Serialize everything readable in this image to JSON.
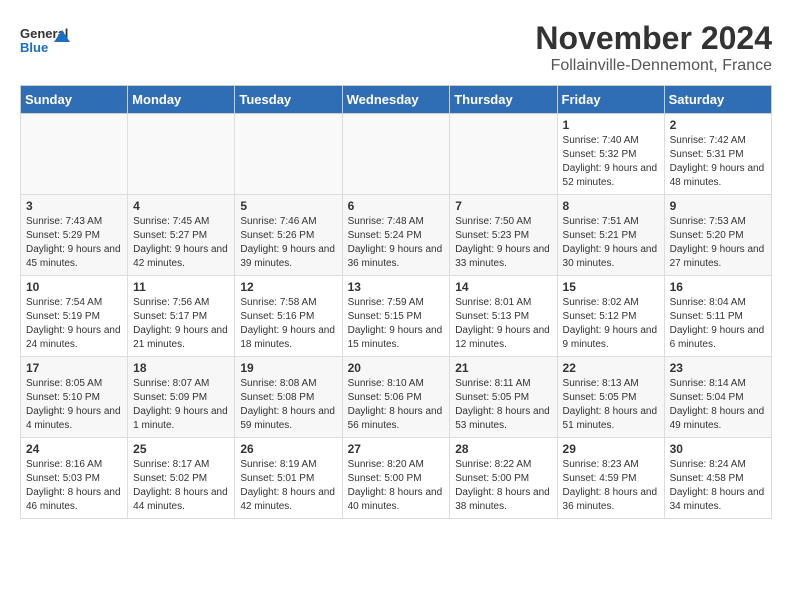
{
  "logo": {
    "text_general": "General",
    "text_blue": "Blue"
  },
  "title": "November 2024",
  "subtitle": "Follainville-Dennemont, France",
  "days_of_week": [
    "Sunday",
    "Monday",
    "Tuesday",
    "Wednesday",
    "Thursday",
    "Friday",
    "Saturday"
  ],
  "weeks": [
    {
      "cells": [
        {
          "day": null,
          "empty": true
        },
        {
          "day": null,
          "empty": true
        },
        {
          "day": null,
          "empty": true
        },
        {
          "day": null,
          "empty": true
        },
        {
          "day": null,
          "empty": true
        },
        {
          "day": "1",
          "sunrise": "Sunrise: 7:40 AM",
          "sunset": "Sunset: 5:32 PM",
          "daylight": "Daylight: 9 hours and 52 minutes."
        },
        {
          "day": "2",
          "sunrise": "Sunrise: 7:42 AM",
          "sunset": "Sunset: 5:31 PM",
          "daylight": "Daylight: 9 hours and 48 minutes."
        }
      ]
    },
    {
      "cells": [
        {
          "day": "3",
          "sunrise": "Sunrise: 7:43 AM",
          "sunset": "Sunset: 5:29 PM",
          "daylight": "Daylight: 9 hours and 45 minutes."
        },
        {
          "day": "4",
          "sunrise": "Sunrise: 7:45 AM",
          "sunset": "Sunset: 5:27 PM",
          "daylight": "Daylight: 9 hours and 42 minutes."
        },
        {
          "day": "5",
          "sunrise": "Sunrise: 7:46 AM",
          "sunset": "Sunset: 5:26 PM",
          "daylight": "Daylight: 9 hours and 39 minutes."
        },
        {
          "day": "6",
          "sunrise": "Sunrise: 7:48 AM",
          "sunset": "Sunset: 5:24 PM",
          "daylight": "Daylight: 9 hours and 36 minutes."
        },
        {
          "day": "7",
          "sunrise": "Sunrise: 7:50 AM",
          "sunset": "Sunset: 5:23 PM",
          "daylight": "Daylight: 9 hours and 33 minutes."
        },
        {
          "day": "8",
          "sunrise": "Sunrise: 7:51 AM",
          "sunset": "Sunset: 5:21 PM",
          "daylight": "Daylight: 9 hours and 30 minutes."
        },
        {
          "day": "9",
          "sunrise": "Sunrise: 7:53 AM",
          "sunset": "Sunset: 5:20 PM",
          "daylight": "Daylight: 9 hours and 27 minutes."
        }
      ]
    },
    {
      "cells": [
        {
          "day": "10",
          "sunrise": "Sunrise: 7:54 AM",
          "sunset": "Sunset: 5:19 PM",
          "daylight": "Daylight: 9 hours and 24 minutes."
        },
        {
          "day": "11",
          "sunrise": "Sunrise: 7:56 AM",
          "sunset": "Sunset: 5:17 PM",
          "daylight": "Daylight: 9 hours and 21 minutes."
        },
        {
          "day": "12",
          "sunrise": "Sunrise: 7:58 AM",
          "sunset": "Sunset: 5:16 PM",
          "daylight": "Daylight: 9 hours and 18 minutes."
        },
        {
          "day": "13",
          "sunrise": "Sunrise: 7:59 AM",
          "sunset": "Sunset: 5:15 PM",
          "daylight": "Daylight: 9 hours and 15 minutes."
        },
        {
          "day": "14",
          "sunrise": "Sunrise: 8:01 AM",
          "sunset": "Sunset: 5:13 PM",
          "daylight": "Daylight: 9 hours and 12 minutes."
        },
        {
          "day": "15",
          "sunrise": "Sunrise: 8:02 AM",
          "sunset": "Sunset: 5:12 PM",
          "daylight": "Daylight: 9 hours and 9 minutes."
        },
        {
          "day": "16",
          "sunrise": "Sunrise: 8:04 AM",
          "sunset": "Sunset: 5:11 PM",
          "daylight": "Daylight: 9 hours and 6 minutes."
        }
      ]
    },
    {
      "cells": [
        {
          "day": "17",
          "sunrise": "Sunrise: 8:05 AM",
          "sunset": "Sunset: 5:10 PM",
          "daylight": "Daylight: 9 hours and 4 minutes."
        },
        {
          "day": "18",
          "sunrise": "Sunrise: 8:07 AM",
          "sunset": "Sunset: 5:09 PM",
          "daylight": "Daylight: 9 hours and 1 minute."
        },
        {
          "day": "19",
          "sunrise": "Sunrise: 8:08 AM",
          "sunset": "Sunset: 5:08 PM",
          "daylight": "Daylight: 8 hours and 59 minutes."
        },
        {
          "day": "20",
          "sunrise": "Sunrise: 8:10 AM",
          "sunset": "Sunset: 5:06 PM",
          "daylight": "Daylight: 8 hours and 56 minutes."
        },
        {
          "day": "21",
          "sunrise": "Sunrise: 8:11 AM",
          "sunset": "Sunset: 5:05 PM",
          "daylight": "Daylight: 8 hours and 53 minutes."
        },
        {
          "day": "22",
          "sunrise": "Sunrise: 8:13 AM",
          "sunset": "Sunset: 5:05 PM",
          "daylight": "Daylight: 8 hours and 51 minutes."
        },
        {
          "day": "23",
          "sunrise": "Sunrise: 8:14 AM",
          "sunset": "Sunset: 5:04 PM",
          "daylight": "Daylight: 8 hours and 49 minutes."
        }
      ]
    },
    {
      "cells": [
        {
          "day": "24",
          "sunrise": "Sunrise: 8:16 AM",
          "sunset": "Sunset: 5:03 PM",
          "daylight": "Daylight: 8 hours and 46 minutes."
        },
        {
          "day": "25",
          "sunrise": "Sunrise: 8:17 AM",
          "sunset": "Sunset: 5:02 PM",
          "daylight": "Daylight: 8 hours and 44 minutes."
        },
        {
          "day": "26",
          "sunrise": "Sunrise: 8:19 AM",
          "sunset": "Sunset: 5:01 PM",
          "daylight": "Daylight: 8 hours and 42 minutes."
        },
        {
          "day": "27",
          "sunrise": "Sunrise: 8:20 AM",
          "sunset": "Sunset: 5:00 PM",
          "daylight": "Daylight: 8 hours and 40 minutes."
        },
        {
          "day": "28",
          "sunrise": "Sunrise: 8:22 AM",
          "sunset": "Sunset: 5:00 PM",
          "daylight": "Daylight: 8 hours and 38 minutes."
        },
        {
          "day": "29",
          "sunrise": "Sunrise: 8:23 AM",
          "sunset": "Sunset: 4:59 PM",
          "daylight": "Daylight: 8 hours and 36 minutes."
        },
        {
          "day": "30",
          "sunrise": "Sunrise: 8:24 AM",
          "sunset": "Sunset: 4:58 PM",
          "daylight": "Daylight: 8 hours and 34 minutes."
        }
      ]
    }
  ]
}
